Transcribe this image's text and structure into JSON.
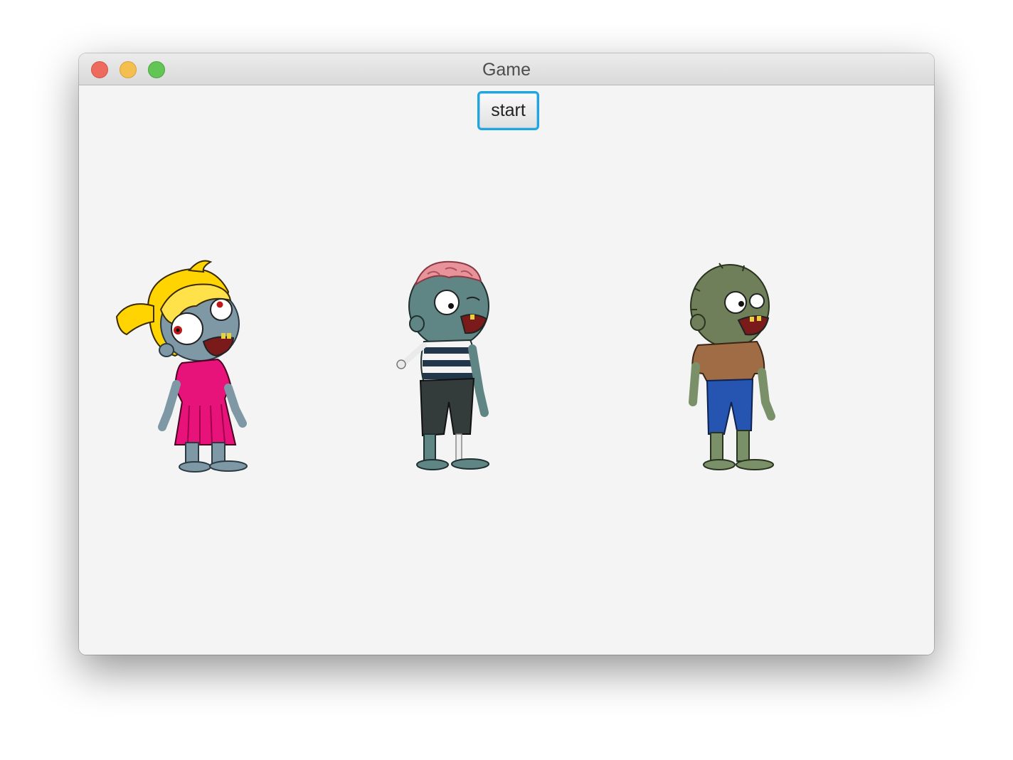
{
  "window": {
    "title": "Game"
  },
  "toolbar": {
    "start_label": "start"
  },
  "characters": [
    {
      "name": "zombie-girl",
      "icon": "zombie-girl-sprite",
      "colors": {
        "hair": "#ffd400",
        "dress": "#e8127b",
        "skin": "#7e98a6"
      }
    },
    {
      "name": "zombie-brain",
      "icon": "zombie-striped-shirt-sprite",
      "colors": {
        "brain": "#e8929a",
        "shirt": "#22384a",
        "skin": "#5f8585"
      }
    },
    {
      "name": "zombie-green",
      "icon": "zombie-brown-shirt-sprite",
      "colors": {
        "shirt": "#a06c45",
        "pants": "#2555b0",
        "skin": "#7a9068"
      }
    }
  ]
}
